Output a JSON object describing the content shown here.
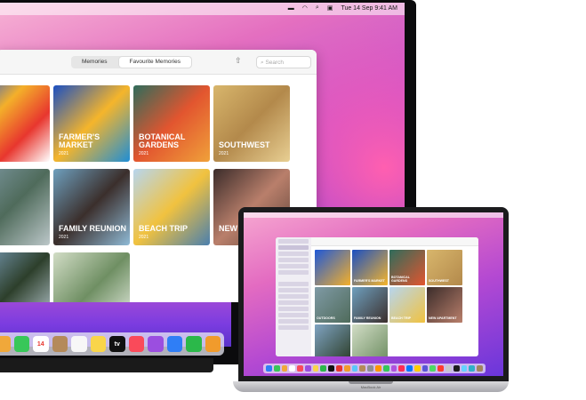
{
  "menubar": {
    "icons": [
      "control-icon",
      "wifi-icon",
      "search-icon",
      "control-center-icon"
    ],
    "datetime": "Tue 14 Sep 9:41 AM"
  },
  "photos": {
    "segments": [
      "Memories",
      "Favourite Memories"
    ],
    "active_segment": "Favourite Memories",
    "search_placeholder": "Search",
    "tiles": [
      {
        "title": "",
        "year": "",
        "colors": [
          "#1e58d8",
          "#f4b02a",
          "#e8362e",
          "#ffffff"
        ]
      },
      {
        "title": "FARMER'S MARKET",
        "year": "2021",
        "colors": [
          "#1a4fc2",
          "#f5b52b",
          "#1f8ed6"
        ]
      },
      {
        "title": "BOTANICAL GARDENS",
        "year": "2021",
        "colors": [
          "#2f6c5b",
          "#e2552f",
          "#f0a13a"
        ]
      },
      {
        "title": "SOUTHWEST",
        "year": "2021",
        "colors": [
          "#d8b66c",
          "#b3894b",
          "#e8cf93"
        ]
      },
      {
        "title": "",
        "year": "",
        "colors": [
          "#7f9aa5",
          "#4f6b5b",
          "#bcc7c9"
        ]
      },
      {
        "title": "FAMILY REUNION",
        "year": "2021",
        "colors": [
          "#6e9fbe",
          "#3b2f2c",
          "#8fbad6"
        ]
      },
      {
        "title": "BEACH TRIP",
        "year": "2021",
        "colors": [
          "#b7d6ef",
          "#f1c23f",
          "#4a7fae"
        ]
      },
      {
        "title": "NEW APARTMENT",
        "year": "",
        "colors": [
          "#3b2c2a",
          "#b97f6b",
          "#5c4238"
        ]
      },
      {
        "title": "",
        "year": "",
        "colors": [
          "#7fa3c2",
          "#2d3f2b",
          "#c4d4de"
        ]
      },
      {
        "title": "",
        "year": "",
        "colors": [
          "#d2ddc6",
          "#6f8f63",
          "#eef3ea"
        ]
      }
    ]
  },
  "dock": {
    "apps": [
      {
        "name": "photos-dock-icon",
        "glyph": "",
        "color": "#f0a83a"
      },
      {
        "name": "facetime-dock-icon",
        "glyph": "",
        "color": "#38c759"
      },
      {
        "name": "calendar-dock-icon",
        "glyph": "14",
        "color": "#ffffff"
      },
      {
        "name": "contacts-dock-icon",
        "glyph": "",
        "color": "#b48a5a"
      },
      {
        "name": "reminders-dock-icon",
        "glyph": "",
        "color": "#f7f7f7"
      },
      {
        "name": "notes-dock-icon",
        "glyph": "",
        "color": "#f9d54a"
      },
      {
        "name": "tv-dock-icon",
        "glyph": "tv",
        "color": "#111111"
      },
      {
        "name": "music-dock-icon",
        "glyph": "",
        "color": "#fa4a5a"
      },
      {
        "name": "podcasts-dock-icon",
        "glyph": "",
        "color": "#9b4ee0"
      },
      {
        "name": "app-store-dock-icon",
        "glyph": "",
        "color": "#2f7ef6"
      },
      {
        "name": "numbers-dock-icon",
        "glyph": "",
        "color": "#2bb84a"
      },
      {
        "name": "keynote-dock-icon",
        "glyph": "",
        "color": "#f19b2c"
      }
    ]
  },
  "laptop": {
    "tiles": [
      {
        "title": "",
        "colors": [
          "#1e58d8",
          "#f4b02a"
        ]
      },
      {
        "title": "FARMER'S MARKET",
        "colors": [
          "#1a4fc2",
          "#f5b52b"
        ]
      },
      {
        "title": "BOTANICAL GARDENS",
        "colors": [
          "#2f6c5b",
          "#e2552f"
        ]
      },
      {
        "title": "SOUTHWEST",
        "colors": [
          "#d8b66c",
          "#b3894b"
        ]
      },
      {
        "title": "OUTDOORS",
        "colors": [
          "#7f9aa5",
          "#4f6b5b"
        ]
      },
      {
        "title": "FAMILY REUNION",
        "colors": [
          "#6e9fbe",
          "#3b2f2c"
        ]
      },
      {
        "title": "BEACH TRIP",
        "colors": [
          "#b7d6ef",
          "#f1c23f"
        ]
      },
      {
        "title": "NEW APARTMENT",
        "colors": [
          "#3b2c2a",
          "#b97f6b"
        ]
      },
      {
        "title": "",
        "colors": [
          "#7fa3c2",
          "#2d3f2b"
        ]
      },
      {
        "title": "",
        "colors": [
          "#d2ddc6",
          "#6f8f63"
        ]
      }
    ],
    "label": "MacBook Air"
  }
}
